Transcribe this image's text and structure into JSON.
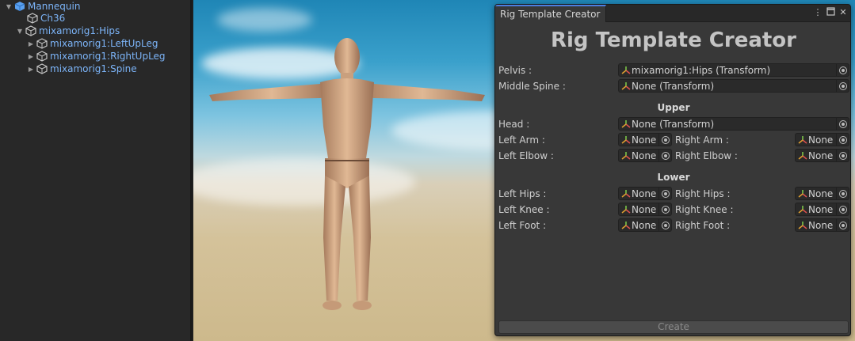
{
  "hierarchy": {
    "items": [
      {
        "label": "Mannequin",
        "icon": "prefab-cube-icon"
      },
      {
        "label": "Ch36",
        "icon": "gameobject-cube-icon"
      },
      {
        "label": "mixamorig1:Hips",
        "icon": "gameobject-cube-icon"
      },
      {
        "label": "mixamorig1:LeftUpLeg",
        "icon": "gameobject-cube-icon"
      },
      {
        "label": "mixamorig1:RightUpLeg",
        "icon": "gameobject-cube-icon"
      },
      {
        "label": "mixamorig1:Spine",
        "icon": "gameobject-cube-icon"
      }
    ]
  },
  "window": {
    "tab_label": "Rig Template Creator",
    "title": "Rig Template Creator",
    "menu_icon": "kebab-menu-icon",
    "maximize_icon": "maximize-icon",
    "close_icon": "close-icon",
    "create_label": "Create"
  },
  "fields": {
    "pelvis": {
      "label": "Pelvis :",
      "value": "mixamorig1:Hips (Transform)"
    },
    "middle_spine": {
      "label": "Middle Spine :",
      "value": "None (Transform)"
    },
    "upper_title": "Upper",
    "head": {
      "label": "Head :",
      "value": "None (Transform)"
    },
    "left_arm": {
      "label": "Left Arm :",
      "value": "None"
    },
    "right_arm": {
      "label": "Right Arm :",
      "value": "None"
    },
    "left_elbow": {
      "label": "Left Elbow :",
      "value": "None"
    },
    "right_elbow": {
      "label": "Right Elbow :",
      "value": "None"
    },
    "lower_title": "Lower",
    "left_hips": {
      "label": "Left Hips :",
      "value": "None"
    },
    "right_hips": {
      "label": "Right Hips :",
      "value": "None"
    },
    "left_knee": {
      "label": "Left Knee :",
      "value": "None"
    },
    "right_knee": {
      "label": "Right Knee :",
      "value": "None"
    },
    "left_foot": {
      "label": "Left Foot :",
      "value": "None"
    },
    "right_foot": {
      "label": "Right Foot :",
      "value": "None"
    }
  },
  "colors": {
    "accent": "#4c7ee0",
    "hierarchy_text": "#7cb4f8",
    "panel_bg": "#383838"
  }
}
